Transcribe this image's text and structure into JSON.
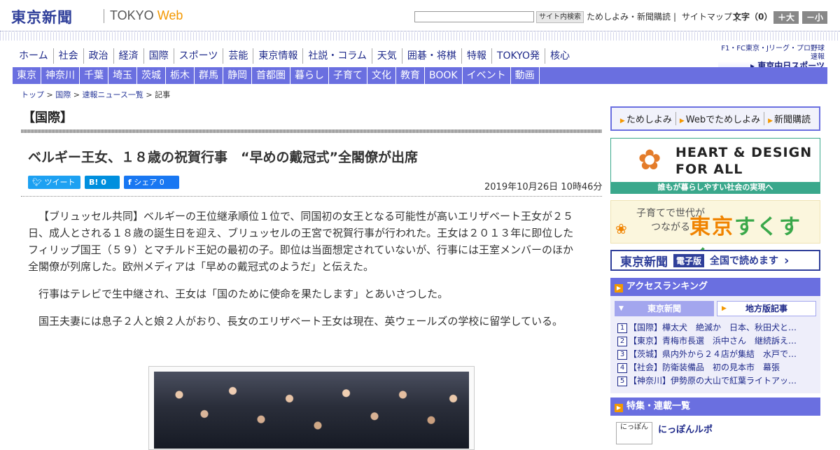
{
  "header": {
    "logo_ja": "東京新聞",
    "logo_tokyo": "TOKYO",
    "logo_web": "Web",
    "search_button": "サイト内検索",
    "links": [
      "ためしよみ・新聞購読",
      "サイトマップ"
    ],
    "font_size_label": "文字（0）",
    "font_plus": "＋大",
    "font_minus": "－小"
  },
  "nav_main": [
    "ホーム",
    "社会",
    "政治",
    "経済",
    "国際",
    "スポーツ",
    "芸能",
    "東京情報",
    "社説・コラム",
    "天気",
    "囲碁・将棋",
    "特報",
    "TOKYO発",
    "核心"
  ],
  "chunichi": {
    "line1": "F1・FC東京・Jリーグ・プロ野球速報",
    "line2": "▸ 東京中日スポーツ"
  },
  "nav_local": [
    "東京",
    "神奈川",
    "千葉",
    "埼玉",
    "茨城",
    "栃木",
    "群馬",
    "静岡",
    "首都圏",
    "暮らし",
    "子育て",
    "文化",
    "教育",
    "BOOK",
    "イベント",
    "動画"
  ],
  "breadcrumb": {
    "top": "トップ",
    "sep": ">",
    "intl": "国際",
    "list": "速報ニュース一覧",
    "current": "記事"
  },
  "section_title": "【国際】",
  "article": {
    "headline": "ベルギー王女、１８歳の祝賀行事　“早めの戴冠式”全閣僚が出席",
    "tweet_label": "ツイート",
    "hatena_label": "B! 0",
    "share_label": "シェア 0",
    "date": "2019年10月26日 10時46分",
    "paragraphs": [
      "【ブリュッセル共同】ベルギーの王位継承順位１位で、同国初の女王となる可能性が高いエリザベート王女が２５日、成人とされる１８歳の誕生日を迎え、ブリュッセルの王宮で祝賀行事が行われた。王女は２０１３年に即位したフィリップ国王（５９）とマチルド王妃の最初の子。即位は当面想定されていないが、行事には王室メンバーのほか全閣僚が列席した。欧州メディアは「早めの戴冠式のようだ」と伝えた。",
      "行事はテレビで生中継され、王女は「国のために使命を果たします」とあいさつした。",
      "国王夫妻には息子２人と娘２人がおり、長女のエリザベート王女は現在、英ウェールズの学校に留学している。"
    ]
  },
  "sidebar": {
    "trial": [
      "ためしよみ",
      "Webでためしよみ",
      "新聞購読"
    ],
    "heart_design": {
      "title1": "HEART & DESIGN",
      "title2": "FOR ALL",
      "strip": "誰もが暮らしやすい社会の実現へ"
    },
    "sukusuku": {
      "small1": "子育てで世代が",
      "small2": "つながる",
      "big1": "東京",
      "big2": "すくすく"
    },
    "edition": {
      "logo": "東京新聞",
      "tag": "電子版",
      "text": "全国で読めます",
      "arrow": "›"
    },
    "ranking": {
      "title": "アクセスランキング",
      "tab1": "東京新聞",
      "tab2": "地方版記事",
      "items": [
        {
          "num": "1",
          "text": "【国際】樺太犬　絶滅か　日本、秋田犬と…"
        },
        {
          "num": "2",
          "text": "【東京】青梅市長選　浜中さん　継続訴え…"
        },
        {
          "num": "3",
          "text": "【茨城】県内外から２４店が集結　水戸で…"
        },
        {
          "num": "4",
          "text": "【社会】防衛装備品　初の見本市　幕張"
        },
        {
          "num": "5",
          "text": "【神奈川】伊勢原の大山で紅葉ライトアッ…"
        }
      ]
    },
    "features": {
      "title": "特集・連載一覧",
      "thumb": "にっぽん",
      "item": "にっぽんルポ"
    }
  },
  "colors": {
    "brand": "#2f3f9a",
    "nav_bg": "#6a6fe0",
    "accent": "#f39800"
  }
}
